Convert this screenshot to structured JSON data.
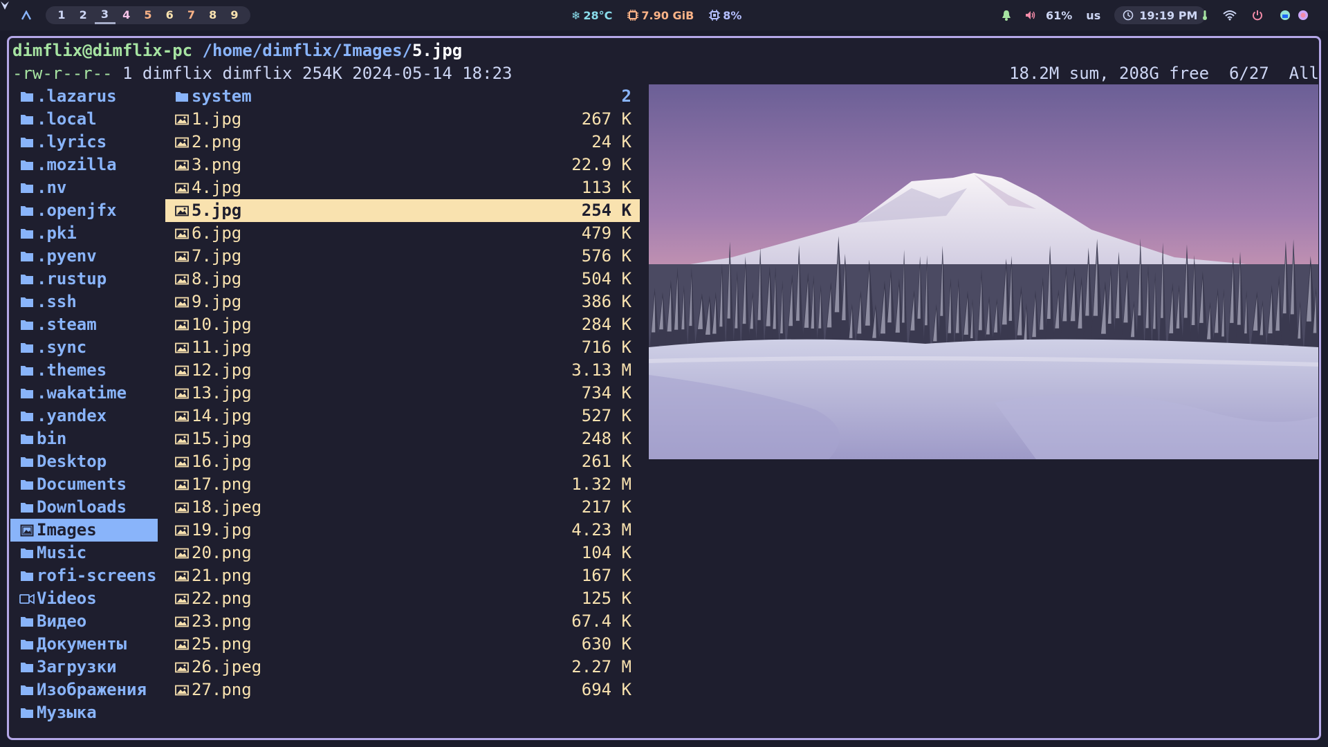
{
  "topbar": {
    "workspaces": [
      {
        "label": "1",
        "color": "#cdd6f4"
      },
      {
        "label": "2",
        "color": "#cdd6f4"
      },
      {
        "label": "3",
        "color": "#cdd6f4"
      },
      {
        "label": "4",
        "color": "#f5c2e7"
      },
      {
        "label": "5",
        "color": "#fab387"
      },
      {
        "label": "6",
        "color": "#f9e2af"
      },
      {
        "label": "7",
        "color": "#fab387"
      },
      {
        "label": "8",
        "color": "#f9e2af"
      },
      {
        "label": "9",
        "color": "#f9e2af"
      }
    ],
    "active_workspace": "3",
    "temperature": "28°C",
    "memory": "7.90 GiB",
    "cpu": "8%",
    "volume": "61%",
    "keyboard_layout": "us",
    "clock": "19:19 PM",
    "colors": {
      "temp": "#89dceb",
      "mem": "#fab387",
      "cpu": "#b4befe",
      "volume": "#f38ba8",
      "bell": "#a6e3a1",
      "power": "#f38ba8"
    }
  },
  "terminal": {
    "path_user": "dimflix@dimflix-pc",
    "path_dir": " /home/dimflix/Images/",
    "path_file": "5.jpg",
    "meta_permissions": "-rw-r--r--",
    "meta_rest": " 1 dimflix dimflix 254K 2024-05-14 18:23",
    "status_right": "18.2M sum, 208G free  6/27  All"
  },
  "parent_dir": [
    {
      "name": ".lazarus",
      "icon": "folder-icon"
    },
    {
      "name": ".local",
      "icon": "folder-icon"
    },
    {
      "name": ".lyrics",
      "icon": "folder-icon"
    },
    {
      "name": ".mozilla",
      "icon": "folder-icon"
    },
    {
      "name": ".nv",
      "icon": "folder-icon"
    },
    {
      "name": ".openjfx",
      "icon": "folder-icon"
    },
    {
      "name": ".pki",
      "icon": "folder-icon"
    },
    {
      "name": ".pyenv",
      "icon": "folder-icon"
    },
    {
      "name": ".rustup",
      "icon": "folder-icon"
    },
    {
      "name": ".ssh",
      "icon": "folder-icon"
    },
    {
      "name": ".steam",
      "icon": "folder-icon"
    },
    {
      "name": ".sync",
      "icon": "folder-icon"
    },
    {
      "name": ".themes",
      "icon": "folder-icon"
    },
    {
      "name": ".wakatime",
      "icon": "folder-icon"
    },
    {
      "name": ".yandex",
      "icon": "folder-icon"
    },
    {
      "name": "bin",
      "icon": "folder-icon"
    },
    {
      "name": "Desktop",
      "icon": "folder-icon"
    },
    {
      "name": "Documents",
      "icon": "folder-icon"
    },
    {
      "name": "Downloads",
      "icon": "folder-icon"
    },
    {
      "name": "Images",
      "icon": "image-folder-icon",
      "selected": true
    },
    {
      "name": "Music",
      "icon": "folder-icon"
    },
    {
      "name": "rofi-screens",
      "icon": "folder-icon"
    },
    {
      "name": "Videos",
      "icon": "video-icon"
    },
    {
      "name": "Видео",
      "icon": "folder-icon"
    },
    {
      "name": "Документы",
      "icon": "folder-icon"
    },
    {
      "name": "Загрузки",
      "icon": "folder-icon"
    },
    {
      "name": "Изображения",
      "icon": "folder-icon"
    },
    {
      "name": "Музыка",
      "icon": "folder-icon"
    }
  ],
  "current_dir": [
    {
      "name": "system",
      "size": "2",
      "icon": "folder-icon",
      "dir": true
    },
    {
      "name": "1.jpg",
      "size": "267 K",
      "icon": "image-file-icon"
    },
    {
      "name": "2.png",
      "size": "24 K",
      "icon": "image-file-icon"
    },
    {
      "name": "3.png",
      "size": "22.9 K",
      "icon": "image-file-icon"
    },
    {
      "name": "4.jpg",
      "size": "113 K",
      "icon": "image-file-icon"
    },
    {
      "name": "5.jpg",
      "size": "254 K",
      "icon": "image-file-icon",
      "selected": true
    },
    {
      "name": "6.jpg",
      "size": "479 K",
      "icon": "image-file-icon"
    },
    {
      "name": "7.jpg",
      "size": "576 K",
      "icon": "image-file-icon"
    },
    {
      "name": "8.jpg",
      "size": "504 K",
      "icon": "image-file-icon"
    },
    {
      "name": "9.jpg",
      "size": "386 K",
      "icon": "image-file-icon"
    },
    {
      "name": "10.jpg",
      "size": "284 K",
      "icon": "image-file-icon"
    },
    {
      "name": "11.jpg",
      "size": "716 K",
      "icon": "image-file-icon"
    },
    {
      "name": "12.jpg",
      "size": "3.13 M",
      "icon": "image-file-icon"
    },
    {
      "name": "13.jpg",
      "size": "734 K",
      "icon": "image-file-icon"
    },
    {
      "name": "14.jpg",
      "size": "527 K",
      "icon": "image-file-icon"
    },
    {
      "name": "15.jpg",
      "size": "248 K",
      "icon": "image-file-icon"
    },
    {
      "name": "16.jpg",
      "size": "261 K",
      "icon": "image-file-icon"
    },
    {
      "name": "17.png",
      "size": "1.32 M",
      "icon": "image-file-icon"
    },
    {
      "name": "18.jpeg",
      "size": "217 K",
      "icon": "image-file-icon"
    },
    {
      "name": "19.jpg",
      "size": "4.23 M",
      "icon": "image-file-icon"
    },
    {
      "name": "20.png",
      "size": "104 K",
      "icon": "image-file-icon"
    },
    {
      "name": "21.png",
      "size": "167 K",
      "icon": "image-file-icon"
    },
    {
      "name": "22.png",
      "size": "125 K",
      "icon": "image-file-icon"
    },
    {
      "name": "23.png",
      "size": "67.4 K",
      "icon": "image-file-icon"
    },
    {
      "name": "25.png",
      "size": "630 K",
      "icon": "image-file-icon"
    },
    {
      "name": "26.jpeg",
      "size": "2.27 M",
      "icon": "image-file-icon"
    },
    {
      "name": "27.png",
      "size": "694 K",
      "icon": "image-file-icon"
    }
  ],
  "preview": {
    "subject": "snowy-mountain-landscape"
  }
}
